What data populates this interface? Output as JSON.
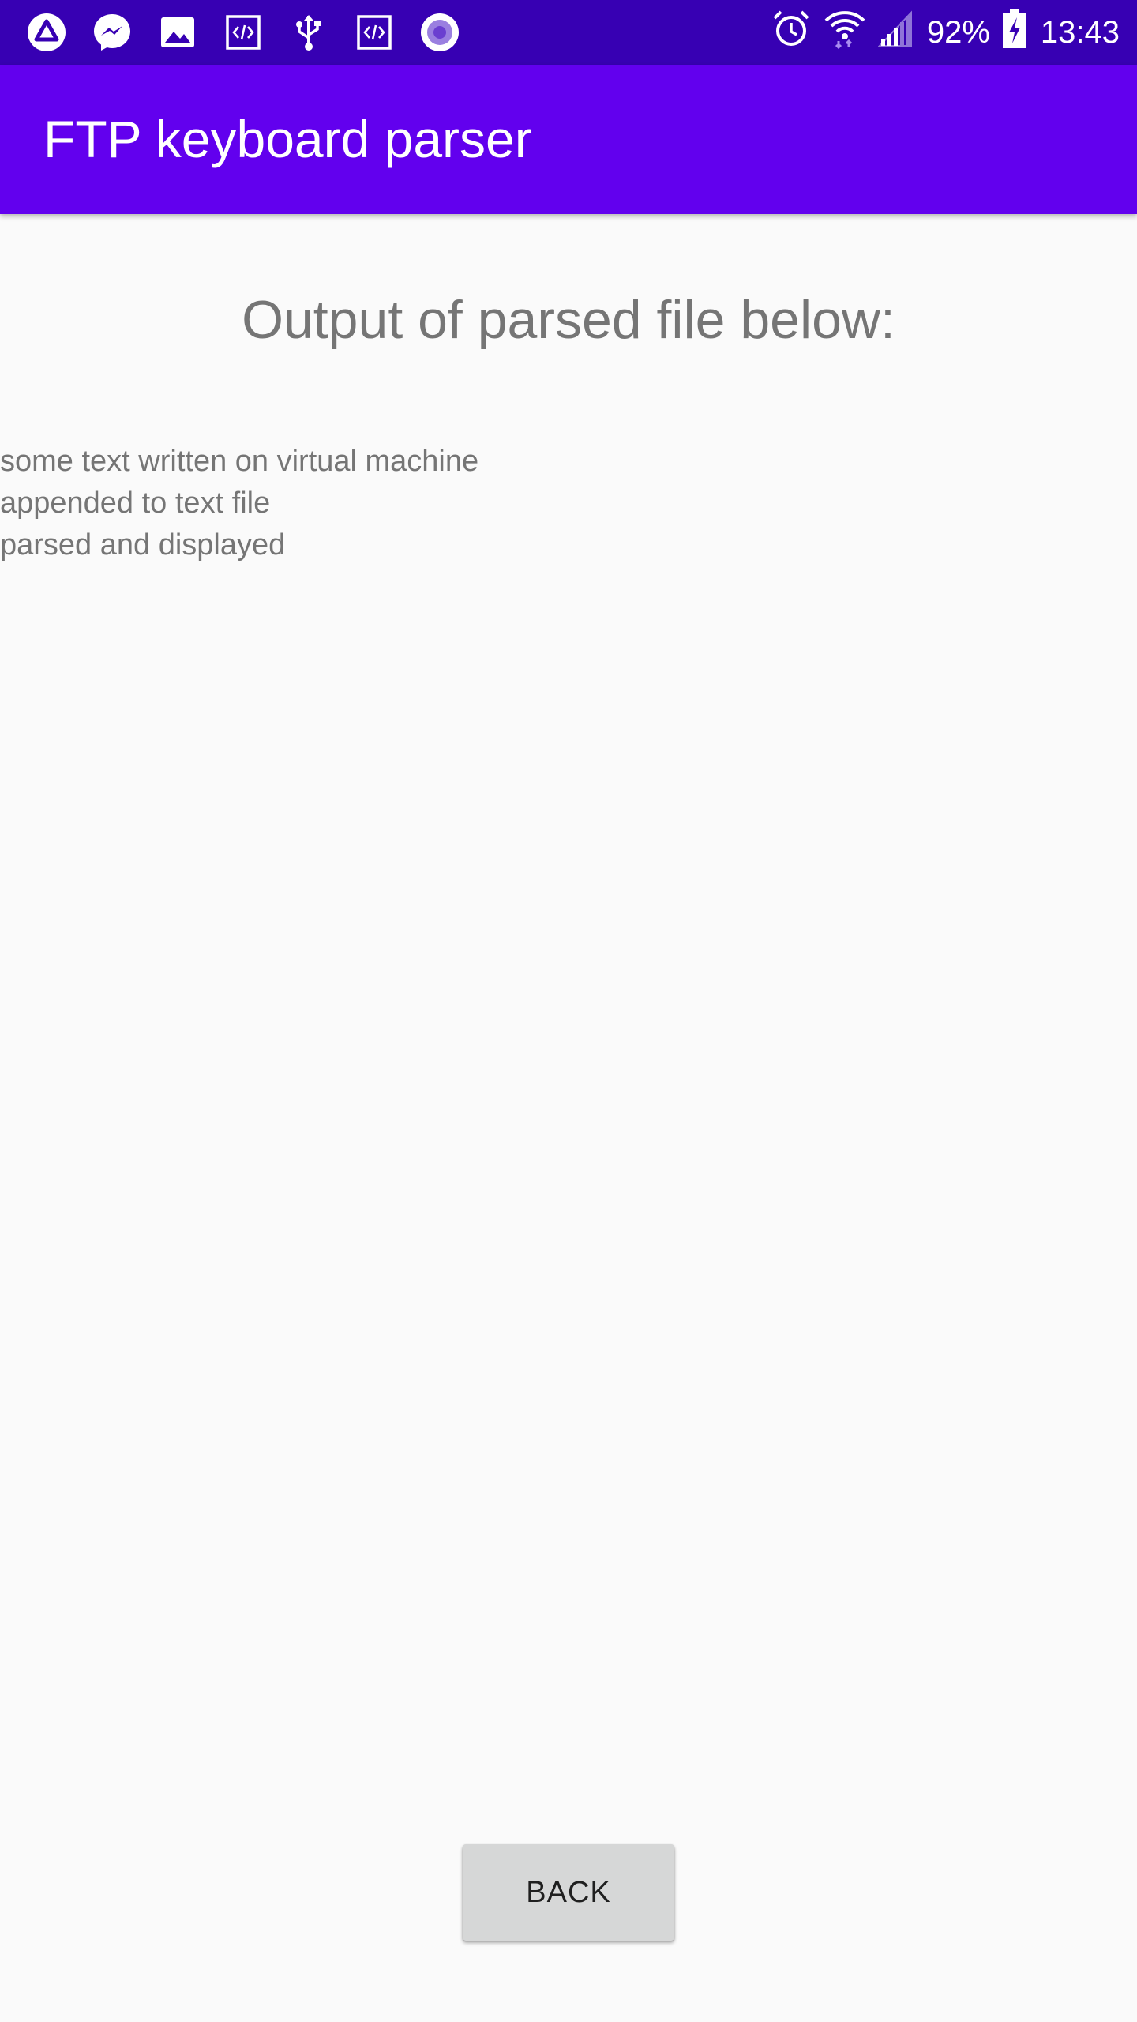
{
  "status_bar": {
    "notification_icons": [
      "drive-icon",
      "messenger-icon",
      "gallery-icon",
      "code-icon",
      "usb-icon",
      "code-icon",
      "record-icon"
    ],
    "alarm_icon": "alarm-icon",
    "wifi_icon": "wifi-icon",
    "signal_icon": "signal-icon",
    "battery_percent": "92%",
    "battery_icon": "battery-charging-icon",
    "time": "13:43",
    "background_color": "#3700b3"
  },
  "app_bar": {
    "title": "FTP keyboard parser",
    "background_color": "#6200ee"
  },
  "main": {
    "heading": "Output of parsed file below:",
    "output_lines": [
      "some text written on virtual machine",
      "appended to text file",
      "parsed and displayed"
    ]
  },
  "footer": {
    "back_label": "BACK"
  }
}
